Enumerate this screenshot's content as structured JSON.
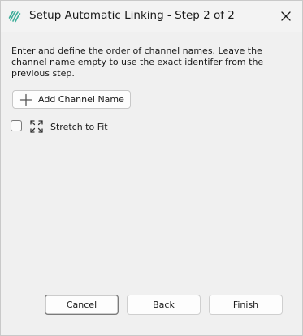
{
  "window": {
    "title": "Setup Automatic Linking - Step 2 of 2",
    "app_icon": "waves-logo-icon",
    "close_icon": "close-icon"
  },
  "main": {
    "instructions": "Enter and define the order of channel names. Leave the channel name empty to use the exact identifer from the previous step.",
    "add_channel_button": {
      "label": "Add Channel Name",
      "icon": "plus-icon"
    },
    "stretch_to_fit": {
      "label": "Stretch to Fit",
      "checked": false,
      "icon": "expand-arrows-icon"
    }
  },
  "footer": {
    "cancel_label": "Cancel",
    "back_label": "Back",
    "finish_label": "Finish"
  }
}
